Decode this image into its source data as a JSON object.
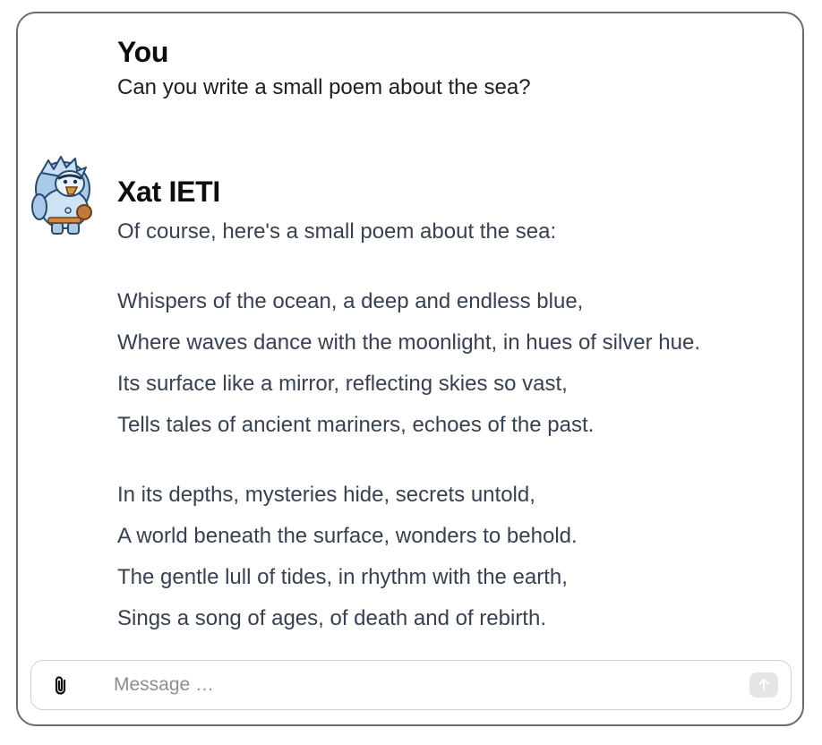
{
  "conversation": {
    "user": {
      "name": "You",
      "message": "Can you write a small poem about the sea?"
    },
    "assistant": {
      "name": "Xat IETI",
      "avatar": "yeti-avatar",
      "intro": "Of course, here's a small poem about the sea:",
      "stanzas": [
        [
          "Whispers of the ocean, a deep and endless blue,",
          "Where waves dance with the moonlight, in hues of silver hue.",
          "Its surface like a mirror, reflecting skies so vast,",
          "Tells tales of ancient mariners, echoes of the past."
        ],
        [
          "In its depths, mysteries hide, secrets untold,",
          "A world beneath the surface, wonders to behold.",
          "The gentle lull of tides, in rhythm with the earth,",
          "Sings a song of ages, of death and of rebirth."
        ]
      ]
    }
  },
  "composer": {
    "placeholder": "Message …",
    "value": "",
    "attach_icon": "paperclip-icon",
    "send_icon": "arrow-up-icon"
  },
  "colors": {
    "border": "#6b6b6b",
    "text_primary": "#0d0d0d",
    "text_body": "#374151",
    "send_button_disabled": "#e5e5e5"
  }
}
